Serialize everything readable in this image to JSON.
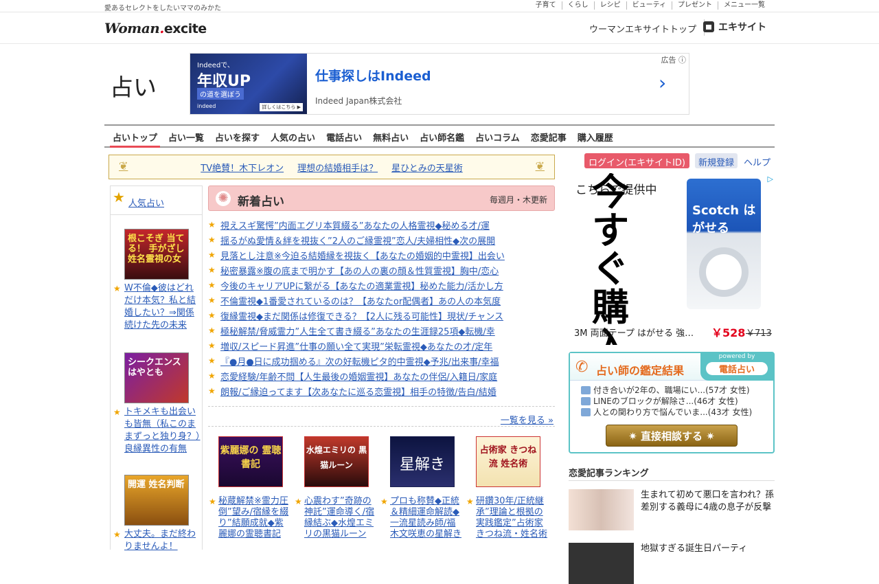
{
  "topbar": {
    "tagline": "愛あるセレクトをしたいママのみかた",
    "nav": [
      "子育て",
      "くらし",
      "レシピ",
      "ビューティ",
      "プレゼント",
      "メニュー一覧"
    ]
  },
  "header": {
    "logo_main": "Woman",
    "logo_dot": ".",
    "logo_ex": "excite",
    "link1": "ウーマンエキサイトトップ",
    "link2": "エキサイト"
  },
  "page_title": "占い",
  "ad_top": {
    "img_l1": "Indeedで、",
    "img_l2": "年収UP",
    "img_l3": "の道を選ぼう",
    "img_l4": "indeed",
    "img_l5": "詳しくはこちら ▶",
    "headline": "仕事探しはIndeed",
    "sub": "Indeed Japan株式会社",
    "label": "広告 ⓘ"
  },
  "gnav": [
    "占いトップ",
    "占い一覧",
    "占いを探す",
    "人気の占い",
    "電話占い",
    "無料占い",
    "占い師名鑑",
    "占いコラム",
    "恋愛記事",
    "購入履歴"
  ],
  "banner": [
    "TV絶賛！木下レオン",
    "理想の結婚相手は？",
    "星ひとみの天星術"
  ],
  "left": {
    "title": "人気占い",
    "items": [
      {
        "img": "根こそぎ 当てる！ 手がざし 姓名霊視の女",
        "text": "W不倫◆彼はどれだけ本気？私と結婚したい？⇒関係続けた先の未来"
      },
      {
        "img": "シークエンス はやとも",
        "text": "トキメキも出会いも皆無（私このままずっと独り身？）良縁異性の有無"
      },
      {
        "img": "開運 姓名判断",
        "text": "大丈夫。まだ終わりませんよ！"
      }
    ]
  },
  "new": {
    "title": "新着占い",
    "update": "毎週月・木更新",
    "items": [
      "視えスギ驚愕”内面エグリ本質綴る”あなたの人格霊視◆秘める才/運",
      "揺るがぬ愛情＆絆を視抜く”2人のご縁霊視”恋人/夫婦相性◆次の展開",
      "見落とし注意※今迫る結婚縁を視抜く【あなたの婚姻的中霊視】出会い",
      "秘密暴露※腹の底まで明かす【あの人の裏の顔＆性質霊視】胸中/恋心",
      "今後のキャリアUPに繋がる【あなたの適業霊視】秘めた能力/活かし方",
      "不倫霊視◆1番愛されているのは？【あなたor配偶者】あの人の本気度",
      "復縁霊視◆まだ関係は修復できる？【2人に残る可能性】現状/チャンス",
      "極秘解禁/脅威霊力”人生全て書き綴る”あなたの生涯録25項◆転機/幸",
      "増収/スピード昇進”仕事の願い全て実現”栄転霊視◆あなたの才/定年",
      "『●月●日に成功掴める』次の好転機ピタ的中霊視◆予兆/出来事/幸福",
      "恋愛経験/年齢不問【人生最後の婚姻霊視】あなたの伴侶/入籍日/家庭",
      "朗報/ご縁迫ってます【次あなたに巡る恋霊視】相手の特徴/告白/結婚"
    ],
    "more": "一覧を見る »"
  },
  "cards": [
    {
      "img": "紫麗娜の 霊聴書記",
      "text": "秘蔵解禁※霊力圧倒”望み/宿縁を綴り”結願成就◆紫麗娜の霊聴書記"
    },
    {
      "img": "水煌エミリの 黒猫ルーン",
      "text": "心震わす”奇跡の神託”運命導く/宿縁結ぶ◆水煌エミリの黒猫ルーン"
    },
    {
      "img": "星解き",
      "text": "プロも称賛◆正統＆精細運命解読◆一流星読み師/福木文咲恵の星解き"
    },
    {
      "img": "占術家 きつね流 姓名術",
      "text": "研鑽30年/正統継承”理論と根拠の実践鑑定”占術家 きつね流・姓名術"
    }
  ],
  "account": {
    "login": "ログイン(エキサイトID)",
    "register": "新規登録",
    "help": "ヘルプ"
  },
  "ad_side": {
    "small": "こちらで提供中",
    "big": "今すぐ購入",
    "brand": "Scotch はがせる",
    "name": "3M 両面テープ はがせる 強…",
    "price": "￥528",
    "old": "￥713",
    "adicon": "▷"
  },
  "fortune": {
    "title": "占い師の鑑定結果",
    "powered": "powered by",
    "service": "電話占い",
    "rows": [
      "付き合いが2年の、職場にい...(57才 女性)",
      "LINEのブロックが解除さ...(46才 女性)",
      "人との関わり方で悩んでいま...(43才 女性)"
    ],
    "button": "✷ 直接相談する ✷"
  },
  "ranking": {
    "title": "恋愛記事ランキング",
    "items": [
      "生まれて初めて悪口を言われ？孫差別する義母に4歳の息子が反撃",
      "地獄すぎる誕生日パーティ"
    ]
  }
}
